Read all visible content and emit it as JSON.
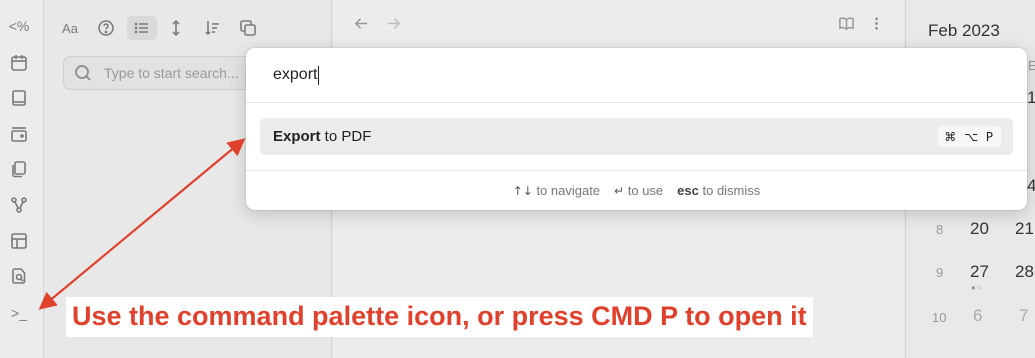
{
  "ribbon": {
    "icons": [
      "code-icon",
      "calendar-icon",
      "book-icon",
      "add-card-icon",
      "files-icon",
      "graph-icon",
      "layout-icon",
      "file-search-icon",
      "terminal-icon"
    ],
    "code_glyph": "<%",
    "terminal_glyph": ">_"
  },
  "explorer": {
    "toolbar_font_glyph": "Aa",
    "search_placeholder": "Type to start search..."
  },
  "calendar": {
    "month_title": "Feb 2023",
    "weekday_fragment": "E",
    "partial_day_top": "1",
    "partial_day_mid": "4",
    "rows": [
      {
        "week": "8",
        "days": [
          "20",
          "21"
        ]
      },
      {
        "week": "9",
        "days": [
          "27",
          "28"
        ]
      },
      {
        "week": "10",
        "days": [
          "6",
          "7"
        ]
      }
    ],
    "dots": "●○"
  },
  "palette": {
    "query": "export",
    "suggestion_match": "Export",
    "suggestion_rest": " to PDF",
    "hotkey": "⌘ ⌥ P",
    "footer": {
      "navigate_key": "↑↓",
      "navigate_label": "to navigate",
      "use_key": "↵",
      "use_label": "to use",
      "dismiss_key": "esc",
      "dismiss_label": "to dismiss"
    }
  },
  "annotation": {
    "text": "Use the command palette icon, or press CMD P to open it",
    "color": "#e0412c"
  }
}
